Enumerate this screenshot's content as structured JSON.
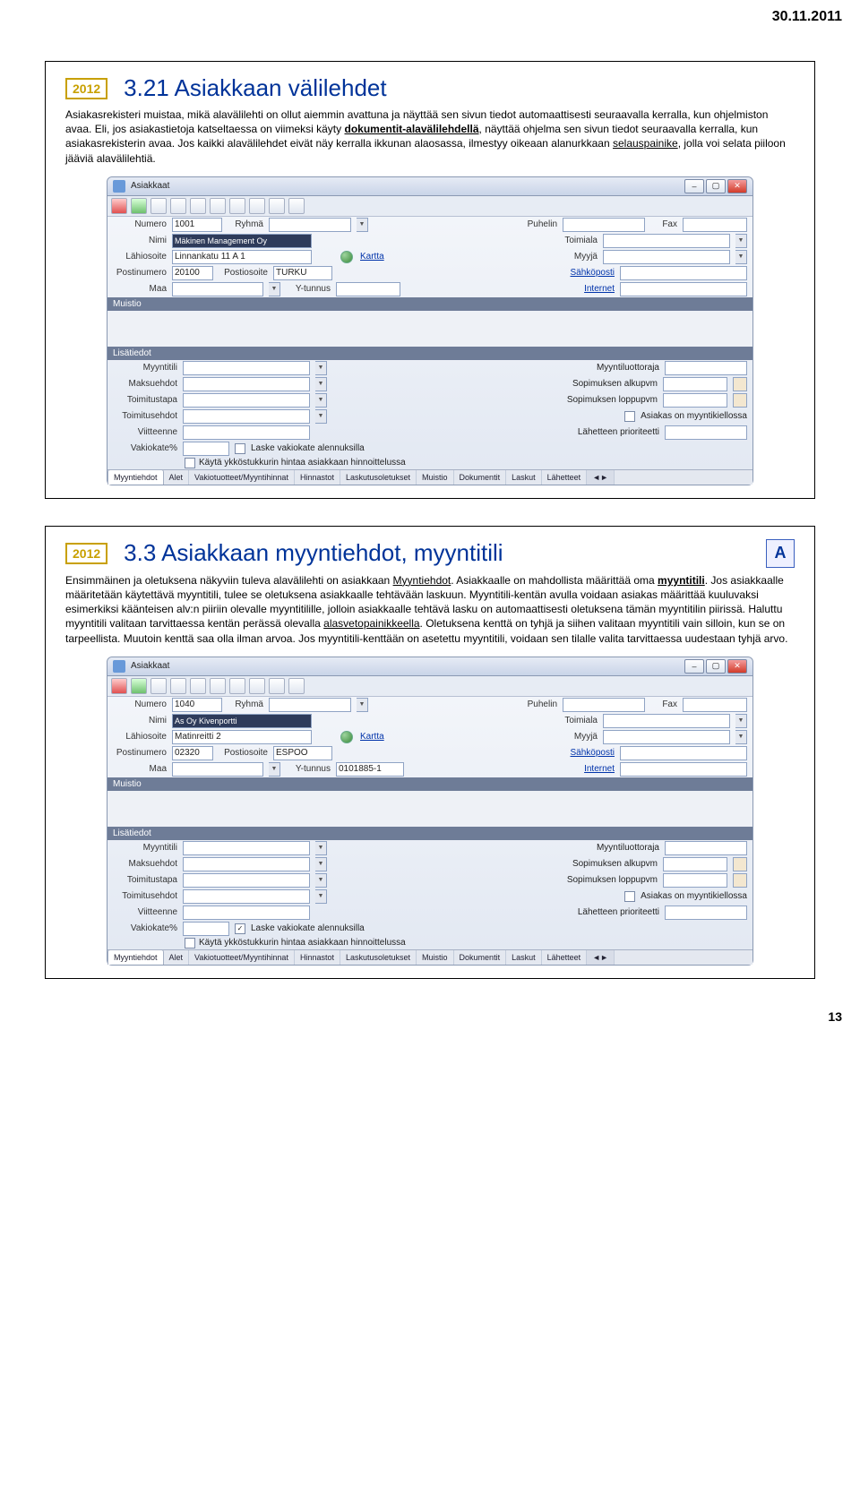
{
  "page": {
    "date": "30.11.2011",
    "number": "13"
  },
  "slide1": {
    "year": "2012",
    "title": "3.21 Asiakkaan välilehdet",
    "para1_a": "Asiakasrekisteri muistaa, mikä alavälilehti on ollut aiemmin avattuna ja näyttää sen sivun tiedot automaattisesti seuraavalla kerralla, kun ohjelmiston avaa. Eli, jos asiakastietoja katseltaessa on viimeksi käyty ",
    "para1_b": "dokumentit-alavälilehdellä",
    "para1_c": ", näyttää ohjelma sen sivun tiedot seuraavalla kerralla, kun asiakasrekisterin avaa. Jos kaikki alavälilehdet eivät näy kerralla ikkunan alaosassa, ilmestyy oikeaan alanurkkaan ",
    "para1_d": "selauspainike",
    "para1_e": ", jolla voi selata piiloon jääviä alavälilehtiä.",
    "win": {
      "title": "Asiakkaat",
      "numero_lbl": "Numero",
      "numero": "1001",
      "ryhma_lbl": "Ryhmä",
      "puhelin_lbl": "Puhelin",
      "fax_lbl": "Fax",
      "nimi_lbl": "Nimi",
      "nimi": "Mäkinen Management Oy",
      "toimiala_lbl": "Toimiala",
      "lahi_lbl": "Lähiosoite",
      "lahi": "Linnankatu 11 A 1",
      "kartta_lbl": "Kartta",
      "myyja_lbl": "Myyjä",
      "postinro_lbl": "Postinumero",
      "postinro": "20100",
      "postios_lbl": "Postiosoite",
      "postios": "TURKU",
      "sahkoposti_lbl": "Sähköposti",
      "maa_lbl": "Maa",
      "ytunnus_lbl": "Y-tunnus",
      "internet_lbl": "Internet",
      "muistio": "Muistio",
      "lisatiedot": "Lisätiedot",
      "myyntitili_lbl": "Myyntitili",
      "myyntiluottoraja_lbl": "Myyntiluottoraja",
      "maksuehdot_lbl": "Maksuehdot",
      "sop_alku": "Sopimuksen alkupvm",
      "toimitustapa_lbl": "Toimitustapa",
      "sop_loppu": "Sopimuksen loppupvm",
      "toimitusehdot_lbl": "Toimitusehdot",
      "asiakas_kiel": "Asiakas on myyntikiellossa",
      "viitteenne_lbl": "Viitteenne",
      "lahetteen_prio": "Lähetteen prioriteetti",
      "vakiokate_lbl": "Vakiokate%",
      "laske_vakiokate": "Laske vakiokate alennuksilla",
      "kayta_ykkoskurin": "Käytä ykköstukkurin hintaa asiakkaan hinnoittelussa",
      "tabs": [
        "Myyntiehdot",
        "Alet",
        "Vakiotuotteet/Myyntihinnat",
        "Hinnastot",
        "Laskutusoletukset",
        "Muistio",
        "Dokumentit",
        "Laskut",
        "Lähetteet"
      ],
      "tab_scroll": "◄►"
    }
  },
  "slide2": {
    "year": "2012",
    "title": "3.3 Asiakkaan myyntiehdot, myyntitili",
    "icon_letter": "A",
    "para_a": "Ensimmäinen ja oletuksena näkyviin tuleva alavälilehti on asiakkaan ",
    "para_b": "Myyntiehdot",
    "para_c": ". Asiakkaalle on mahdollista määrittää oma ",
    "para_d": "myyntitili",
    "para_e": ". Jos asiakkaalle määritetään käytettävä myyntitili, tulee se oletuksena asiakkaalle tehtävään laskuun. Myyntitili-kentän avulla voidaan asiakas määrittää kuuluvaksi esimerkiksi käänteisen alv:n piiriin olevalle myyntitilille, jolloin asiakkaalle tehtävä lasku on automaattisesti oletuksena tämän myyntitilin piirissä. Haluttu myyntitili valitaan tarvittaessa kentän perässä olevalla ",
    "para_f": "alasvetopainikkeella",
    "para_g": ". Oletuksena kenttä on tyhjä ja siihen valitaan myyntitili vain silloin, kun se on tarpeellista. Muutoin kenttä saa olla ilman arvoa. Jos myyntitili-kenttään on asetettu myyntitili, voidaan sen tilalle valita tarvittaessa uudestaan tyhjä arvo.",
    "win": {
      "title": "Asiakkaat",
      "numero": "1040",
      "nimi": "As Oy Kivenportti",
      "lahi": "Matinreitti 2",
      "postinro": "02320",
      "postios": "ESPOO",
      "ytunnus": "0101885-1",
      "chk_laske_checked": "✓"
    }
  }
}
